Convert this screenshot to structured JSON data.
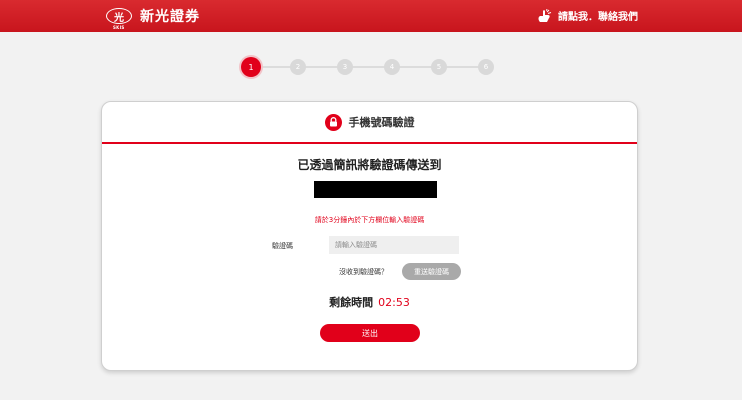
{
  "header": {
    "brand": "新光證券",
    "brand_sub": "SKIS",
    "logo_mark": "光",
    "contact": "請點我．聯絡我們"
  },
  "steps": [
    {
      "label": "1",
      "active": true
    },
    {
      "label": "2",
      "active": false
    },
    {
      "label": "3",
      "active": false
    },
    {
      "label": "4",
      "active": false
    },
    {
      "label": "5",
      "active": false
    },
    {
      "label": "6",
      "active": false
    }
  ],
  "card": {
    "title": "手機號碼驗證",
    "message": "已透過簡訊將驗證碼傳送到",
    "note": "請於3分鐘內於下方欄位輸入驗證碼",
    "code_label": "驗證碼",
    "code_placeholder": "請輸入驗證碼",
    "code_value": "",
    "no_code": "沒收到驗證碼？",
    "resend": "重送驗證碼",
    "timer_label": "剩餘時間",
    "timer_value": "02:53",
    "submit": "送出"
  },
  "colors": {
    "brand_red": "#e1001a",
    "header_red": "#d21e26",
    "step_inactive": "#d9d9d9",
    "resend_gray": "#a9a9a9"
  },
  "icons": {
    "contact": "hand-pointer-icon",
    "title": "lock-icon"
  }
}
